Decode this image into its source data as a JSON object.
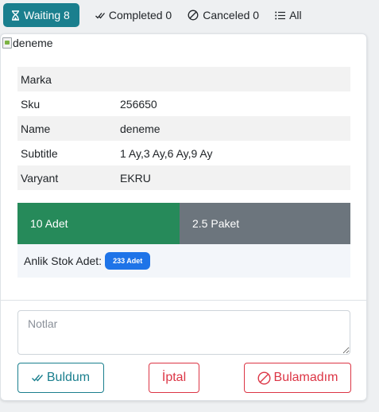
{
  "tabs": [
    {
      "label": "Waiting 8",
      "icon": "hourglass-icon"
    },
    {
      "label": "Completed 0",
      "icon": "check-double-icon"
    },
    {
      "label": "Canceled 0",
      "icon": "ban-icon"
    },
    {
      "label": "All",
      "icon": "list-icon"
    }
  ],
  "product": {
    "image_alt": "deneme",
    "rows": [
      {
        "key": "Marka",
        "value": ""
      },
      {
        "key": "Sku",
        "value": "256650"
      },
      {
        "key": "Name",
        "value": "deneme"
      },
      {
        "key": "Subtitle",
        "value": "1 Ay,3 Ay,6 Ay,9 Ay"
      },
      {
        "key": "Varyant",
        "value": "EKRU"
      }
    ]
  },
  "quantity": {
    "adet_label": "10 Adet",
    "paket_label": "2.5 Paket"
  },
  "stock": {
    "label": "Anlik Stok Adet:",
    "badge": "233 Adet"
  },
  "notes": {
    "placeholder": "Notlar",
    "value": ""
  },
  "actions": {
    "found": "Buldum",
    "cancel": "İptal",
    "not_found": "Bulamadım"
  },
  "colors": {
    "primary": "#1a7f8e",
    "success": "#268a5a",
    "secondary": "#6c757d",
    "danger": "#dc3545",
    "badge": "#1e74e8"
  }
}
